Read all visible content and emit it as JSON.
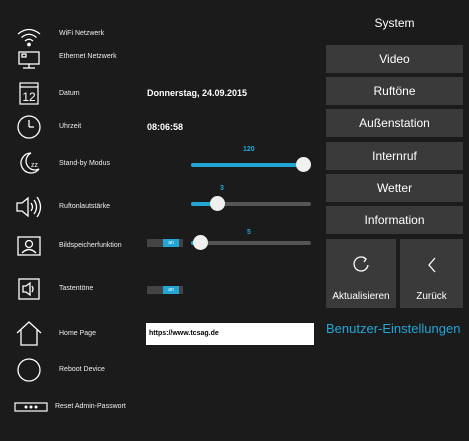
{
  "settings": {
    "wifi": {
      "label": "WiFi Netzwerk",
      "icon": "wifi-icon"
    },
    "ethernet": {
      "label": "Ethernet Netzwerk",
      "icon": "monitor-icon"
    },
    "date": {
      "label": "Datum",
      "value": "Donnerstag, 24.09.2015",
      "icon": "calendar-icon"
    },
    "time": {
      "label": "Uhrzeit",
      "value": "08:06:58",
      "icon": "clock-icon"
    },
    "standby": {
      "label": "Stand-by Modus",
      "value": "120",
      "icon": "moon-icon",
      "level": 0.97
    },
    "ringtone_volume": {
      "label": "Ruftonlautstärke",
      "value": "3",
      "icon": "speaker-icon",
      "level": 0.22
    },
    "image_memory": {
      "label": "Bildspeicherfunktion",
      "value": "5",
      "toggle": "an",
      "icon": "portrait-icon",
      "level": 0.08
    },
    "key_tones": {
      "label": "Tastentöne",
      "toggle": "an",
      "icon": "speaker-box-icon"
    },
    "home_page": {
      "label": "Home Page",
      "url": "https://www.tcsag.de",
      "icon": "house-icon"
    },
    "reboot": {
      "label": "Reboot Device",
      "icon": "circle-icon"
    },
    "reset_admin": {
      "label": "Reset Admin-Passwort",
      "icon": "password-icon"
    }
  },
  "menu": {
    "items": [
      "System",
      "Video",
      "Ruftöne",
      "Außenstation",
      "Internruf",
      "Wetter",
      "Information"
    ],
    "active": "System"
  },
  "actions": {
    "refresh": "Aktualisieren",
    "back": "Zurück"
  },
  "user_settings_label": "Benutzer-Einstellungen",
  "colors": {
    "accent": "#22a6d6",
    "background": "#1b1b1b",
    "button": "#3a3a3a"
  }
}
